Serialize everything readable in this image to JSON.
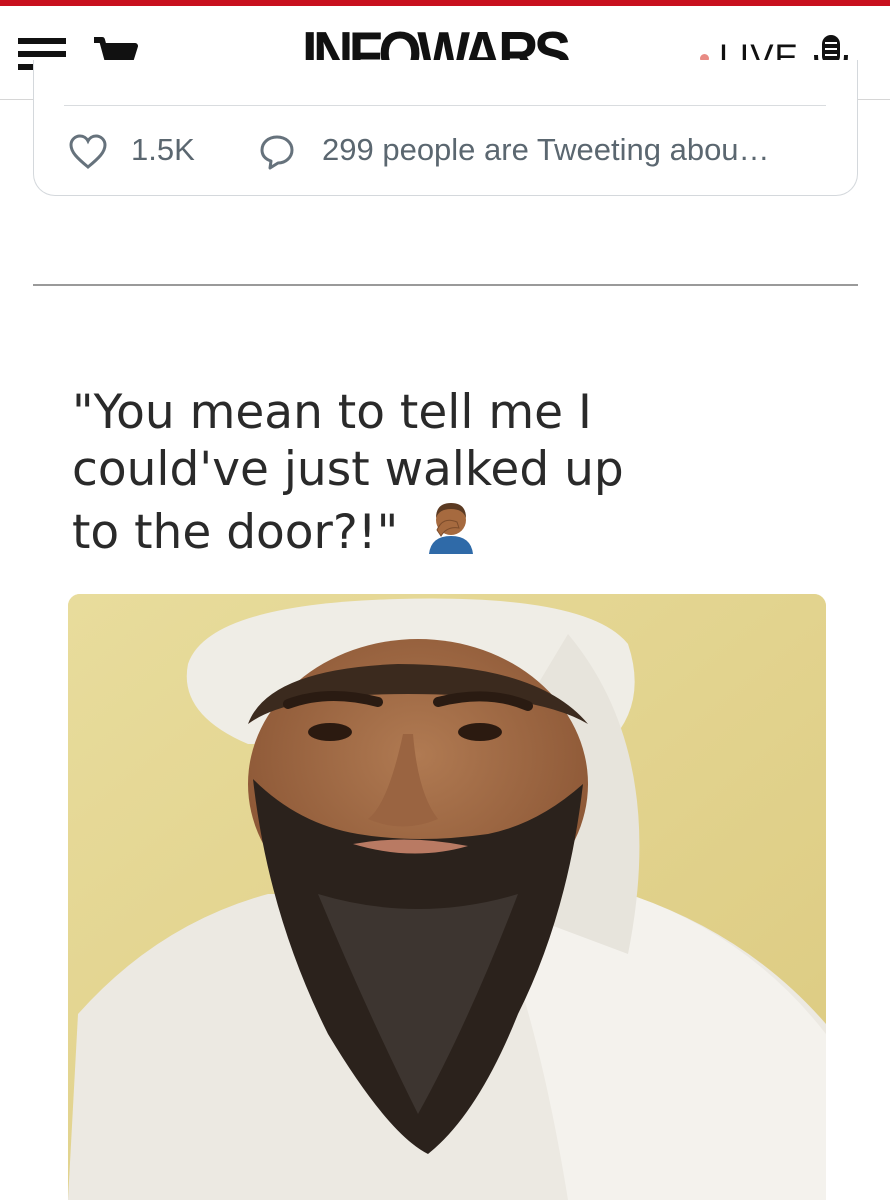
{
  "header": {
    "brand": "INFOWARS",
    "live_label": "LIVE",
    "accent_color": "#c8101e",
    "icons": [
      "menu-icon",
      "cart-icon",
      "microphone-icon"
    ]
  },
  "tweet": {
    "likes": "1.5K",
    "tweeting_text": "299 people are Tweeting abou…",
    "icons": [
      "heart-icon",
      "speech-bubble-icon"
    ]
  },
  "meme": {
    "lines": [
      "\"You mean to tell me I",
      "could've just walked up",
      "to the door?!\""
    ],
    "emoji": "man-facepalming-emoji",
    "photo": "portrait of bearded man in white turban"
  }
}
